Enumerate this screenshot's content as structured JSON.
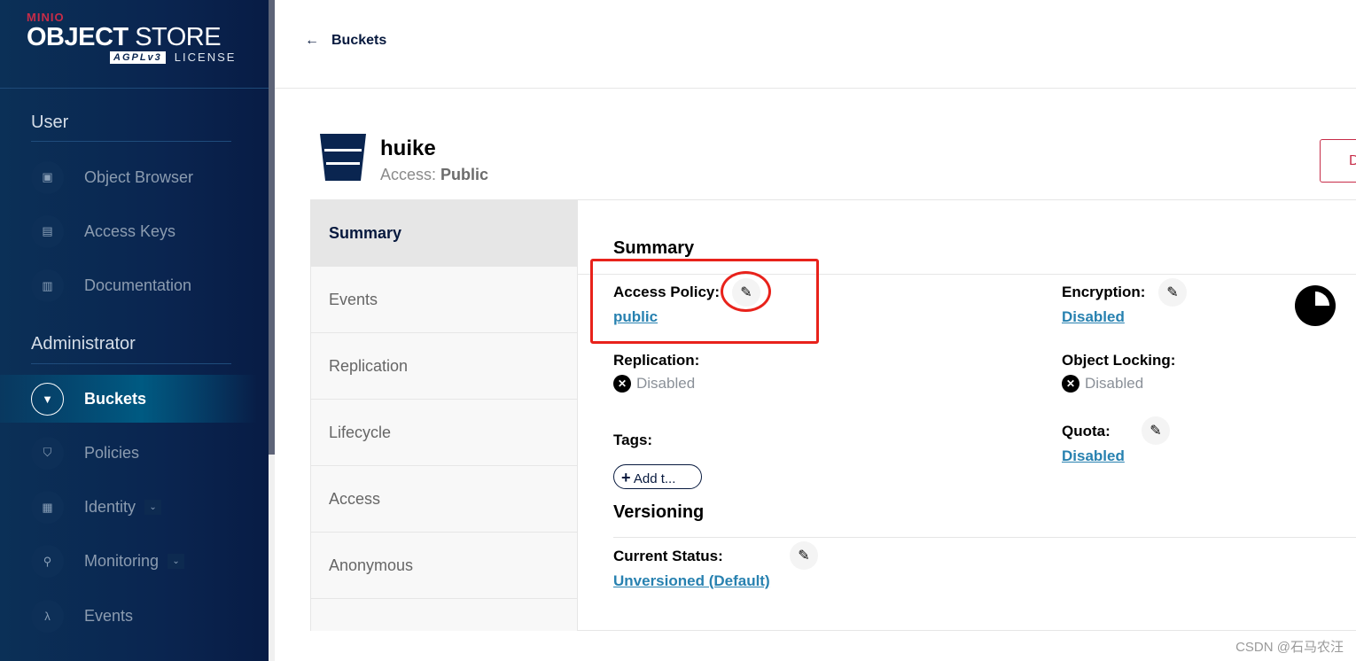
{
  "logo": {
    "brand": "MINIO",
    "product_bold": "OBJECT",
    "product_light": "STORE",
    "license_badge": "AGPLv3",
    "license": "LICENSE"
  },
  "sidebar": {
    "user_section": "User",
    "user_items": [
      {
        "label": "Object Browser",
        "icon": "object-browser-icon"
      },
      {
        "label": "Access Keys",
        "icon": "access-keys-icon"
      },
      {
        "label": "Documentation",
        "icon": "documentation-icon"
      }
    ],
    "admin_section": "Administrator",
    "admin_items": [
      {
        "label": "Buckets",
        "icon": "bucket-icon",
        "active": true
      },
      {
        "label": "Policies",
        "icon": "policy-icon"
      },
      {
        "label": "Identity",
        "icon": "identity-icon",
        "expandable": true
      },
      {
        "label": "Monitoring",
        "icon": "monitoring-icon",
        "expandable": true
      },
      {
        "label": "Events",
        "icon": "lambda-icon"
      }
    ]
  },
  "header": {
    "back_label": "Buckets"
  },
  "bucket": {
    "name": "huike",
    "access_label": "Access:",
    "access_value": "Public",
    "delete_label": "D"
  },
  "tabs": [
    "Summary",
    "Events",
    "Replication",
    "Lifecycle",
    "Access",
    "Anonymous"
  ],
  "summary": {
    "title": "Summary",
    "access_policy_label": "Access Policy:",
    "access_policy_value": "public",
    "encryption_label": "Encryption:",
    "encryption_value": "Disabled",
    "replication_label": "Replication:",
    "replication_value": "Disabled",
    "object_locking_label": "Object Locking:",
    "object_locking_value": "Disabled",
    "tags_label": "Tags:",
    "add_tag_label": "Add t...",
    "quota_label": "Quota:",
    "quota_value": "Disabled"
  },
  "versioning": {
    "title": "Versioning",
    "status_label": "Current Status:",
    "status_value": "Unversioned (Default)"
  },
  "usage_pie_fraction": 0.25,
  "colors": {
    "accent": "#2781b0",
    "danger": "#c72c48",
    "annotation": "#e8221b",
    "sidebar": "#0a2550"
  },
  "watermark": "CSDN @石马农汪"
}
